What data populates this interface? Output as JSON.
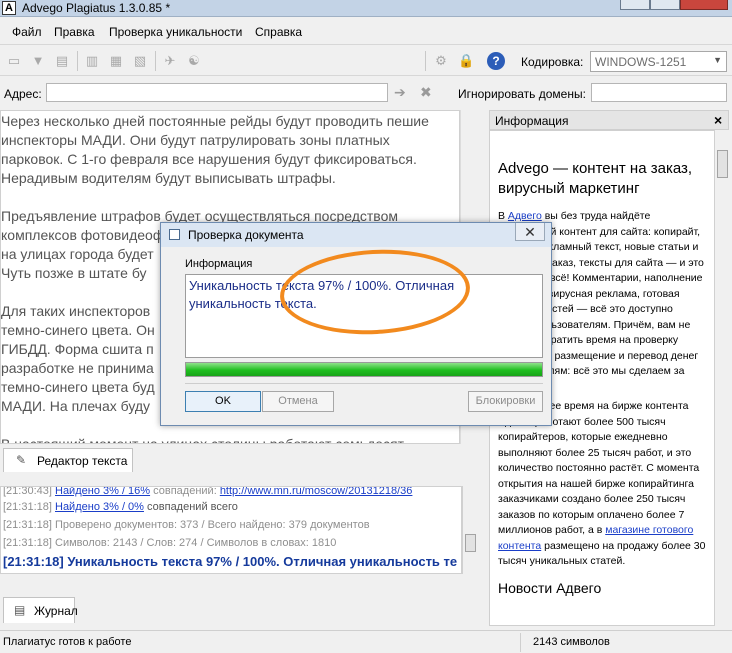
{
  "window": {
    "title": "Advego Plagiatus 1.3.0.85 *",
    "app_icon": "A"
  },
  "menu": [
    "Файл",
    "Правка",
    "Проверка уникальности",
    "Справка"
  ],
  "toolbar": {
    "encoding_label": "Кодировка:",
    "encoding_value": "WINDOWS-1251",
    "help_glyph": "?"
  },
  "address": {
    "label": "Адрес:",
    "value": "",
    "ignore_label": "Игнорировать домены:",
    "ignore_value": ""
  },
  "editor": {
    "paragraphs": [
      [
        "Через несколько дней постоянные рейды будут проводить пешие",
        "инспекторы МАДИ. Они будут патрулировать зоны платных",
        "парковок. С 1-го февраля все нарушения будут фиксироваться.",
        "Нерадивым водителям будут выписывать штрафы."
      ],
      [
        "Предъявление штрафов будет осуществляться посредством",
        "комплексов фотовидеофиксации и портативных планшетов, что",
        "на улицах города будет",
        "Чуть позже в штате бу"
      ],
      [
        "Для таких инспекторов",
        "темно-синего цвета. Он",
        "ГИБДД. Форма сшита п",
        "разработке не принима",
        "темно-синего цвета буд",
        "МАДИ. На плечах буду"
      ],
      [
        "В настоящий момент на улицах столицы работают семьдесят"
      ]
    ],
    "tab_label": "Редактор текста"
  },
  "log": {
    "lines": [
      {
        "time": "[21:30:43]",
        "text": "Найдено 3% / 16%",
        "suffix": " совпадений: ",
        "url": "http://www.mn.ru/moscow/20131218/36"
      },
      {
        "time": "[21:31:18]",
        "text": "Найдено 3% / 0%",
        "suffix": " совпадений всего"
      },
      {
        "time": "[21:31:18]",
        "text": "Проверено документов: 373  / Всего найдено: 379 документов"
      },
      {
        "time": "[21:31:18]",
        "text": "Символов: 2143 / Слов: 274 / Символов в словах: 1810"
      },
      {
        "time": "[21:31:18]",
        "text": "Уникальность текста 97% / 100%. Отличная уникальность те"
      }
    ],
    "tab_label": "Журнал"
  },
  "info": {
    "header": "Информация",
    "close": "×",
    "title": "Advego — контент на заказ, вирусный маркетинг",
    "p1_pre": "В ",
    "p1_link": "Адвего",
    "p1_post": " вы без труда найдёте уникальный контент для сайта: копирайт, рерайт, рекламный текст, новые статьи и статьи на заказ, тексты для сайта — и это далеко не всё! Комментарии, наполнение форумов, вирусная реклама, готовая лента новостей — всё это доступно нашим пользователям. Причём, вам не придётся тратить время на проверку текстов, их размещение и перевод денег исполнителям: всё это мы сделаем за вас.",
    "p2_pre": "В настоящее время на бирже контента Адвего работают более 500 тысяч копирайтеров, которые ежедневно выполняют более 25 тысяч работ, и это количество постоянно растёт. С момента открытия на нашей бирже копирайтинга заказчиками создано более 250 тысяч заказов по которым оплачено более 7 миллионов работ, а в ",
    "p2_link": "магазине готового контента",
    "p2_post": " размещено на продажу более 30 тысяч уникальных статей.",
    "news": "Новости Адвего"
  },
  "status": {
    "left": "Плагиатус готов к работе",
    "right": "2143 символов"
  },
  "dialog": {
    "title": "Проверка документа",
    "close": "✕",
    "info_label": "Информация",
    "message": "Уникальность текста 97% / 100%. Отличная уникальность текста.",
    "progress": 1.0,
    "ok": "OK",
    "cancel": "Отмена",
    "block": "Блокировки"
  },
  "colors": {
    "annotation": "#f28a1e",
    "link": "#1a3ec8",
    "progress": "#1fbf1f"
  }
}
